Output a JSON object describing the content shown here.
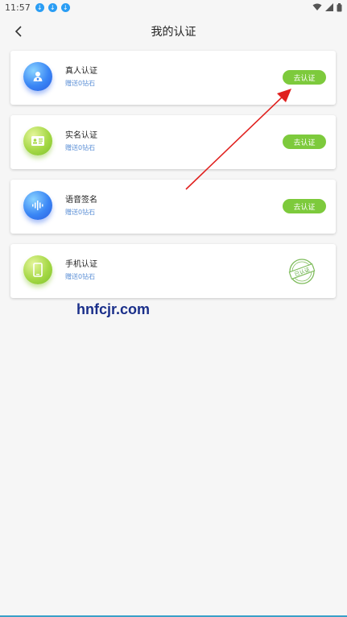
{
  "status_bar": {
    "time": "11:57",
    "notification_icons": [
      "download-icon",
      "download-icon",
      "download-icon"
    ],
    "right_icons": [
      "wifi-icon",
      "signal-icon",
      "battery-icon"
    ]
  },
  "header": {
    "title": "我的认证",
    "back_icon": "chevron-left-icon"
  },
  "cards": [
    {
      "title": "真人认证",
      "subtitle": "赠送0钻石",
      "action": "去认证",
      "icon": "person-lock-icon",
      "color": "#3a86f5"
    },
    {
      "title": "实名认证",
      "subtitle": "赠送0钻石",
      "action": "去认证",
      "icon": "id-card-icon",
      "color": "#a5d845"
    },
    {
      "title": "语音签名",
      "subtitle": "赠送0钻石",
      "action": "去认证",
      "icon": "voice-wave-icon",
      "color": "#3a86f5"
    },
    {
      "title": "手机认证",
      "subtitle": "赠送0钻石",
      "status": "已认证",
      "icon": "phone-icon",
      "color": "#a5d845"
    }
  ],
  "watermark": "hnfcjr.com",
  "colors": {
    "accent_green": "#7dca3c",
    "subtitle_blue": "#5b8fd6",
    "arrow_red": "#e0201e"
  }
}
